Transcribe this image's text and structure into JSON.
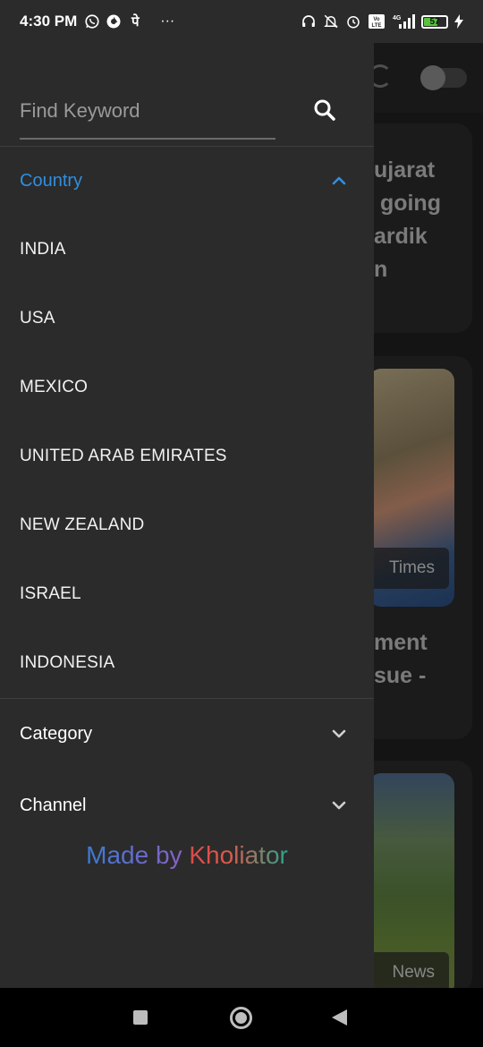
{
  "status_bar": {
    "time": "4:30 PM",
    "left_icons": [
      "whatsapp-icon",
      "app-icon",
      "hindi-char-icon",
      "more-dots-icon"
    ],
    "hindi_char": "पे",
    "more": "···",
    "network": "4G",
    "volte": "Vo LTE",
    "battery": "57",
    "battery_color": "#55c43b"
  },
  "drawer": {
    "search": {
      "placeholder": "Find Keyword",
      "value": ""
    },
    "country": {
      "label": "Country",
      "expanded": true,
      "accent_color": "#2f8fe0",
      "items": [
        "INDIA",
        "USA",
        "MEXICO",
        "UNITED ARAB EMIRATES",
        "NEW ZEALAND",
        "ISRAEL",
        "INDONESIA"
      ]
    },
    "category": {
      "label": "Category",
      "expanded": false
    },
    "channel": {
      "label": "Channel",
      "expanded": false
    },
    "credit": {
      "part1": "Made by ",
      "part2": "Kholiator",
      "gradient_colors": [
        "#3a7bd5",
        "#9b59b6",
        "#e74c3c",
        "#1abc9c"
      ]
    }
  },
  "background": {
    "card1_text": "ujarat\n going\nardik\nn",
    "card2_tag": "Times",
    "card2_text": "ment\nsue -",
    "card3_tag": "News"
  }
}
